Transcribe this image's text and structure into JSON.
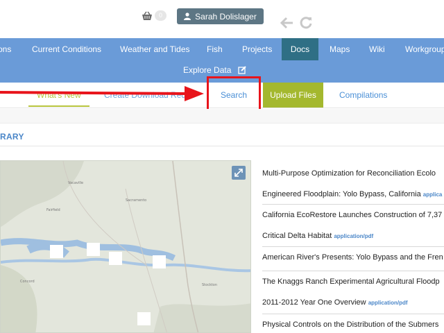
{
  "header": {
    "cart_count": "0",
    "user_name": "Sarah Dolislager"
  },
  "nav": {
    "items": [
      {
        "label": "ons"
      },
      {
        "label": "Current Conditions"
      },
      {
        "label": "Weather and Tides"
      },
      {
        "label": "Fish"
      },
      {
        "label": "Projects"
      },
      {
        "label": "Docs"
      },
      {
        "label": "Maps"
      },
      {
        "label": "Wiki"
      },
      {
        "label": "Workgroup"
      }
    ],
    "explore_label": "Explore Data",
    "active": "Docs"
  },
  "subtabs": {
    "whats_new": "What's New",
    "create_download": "Create Download Reque",
    "search": "Search",
    "upload": "Upload Files",
    "compilations": "Compilations"
  },
  "section": {
    "title": "RARY"
  },
  "documents": [
    {
      "line1": "Multi-Purpose Optimization for Reconciliation Ecolo",
      "line2": "Engineered Floodplain: Yolo Bypass, California",
      "mime": "applica"
    },
    {
      "line1": "California EcoRestore Launches Construction of 7,37",
      "line2": "Critical Delta Habitat",
      "mime": "application/pdf"
    },
    {
      "line1": "American River's Presents: Yolo Bypass and the Fren",
      "line2": "",
      "mime": ""
    },
    {
      "line1": "The Knaggs Ranch Experimental Agricultural Floodp",
      "line2": "2011-2012 Year One Overview",
      "mime": "application/pdf"
    },
    {
      "line1": "Physical Controls on the Distribution of the Submers",
      "line2": "",
      "mime": ""
    }
  ],
  "colors": {
    "nav_blue": "#6a9bd8",
    "nav_active": "#2f6f85",
    "upload_green": "#a4b82e",
    "annotation_red": "#e8141b",
    "link_blue": "#4a8fd6"
  },
  "icons": {
    "cart": "shopping-basket-icon",
    "user": "user-icon",
    "back": "arrow-left-icon",
    "refresh": "refresh-icon",
    "edit": "edit-icon",
    "expand": "expand-icon"
  }
}
